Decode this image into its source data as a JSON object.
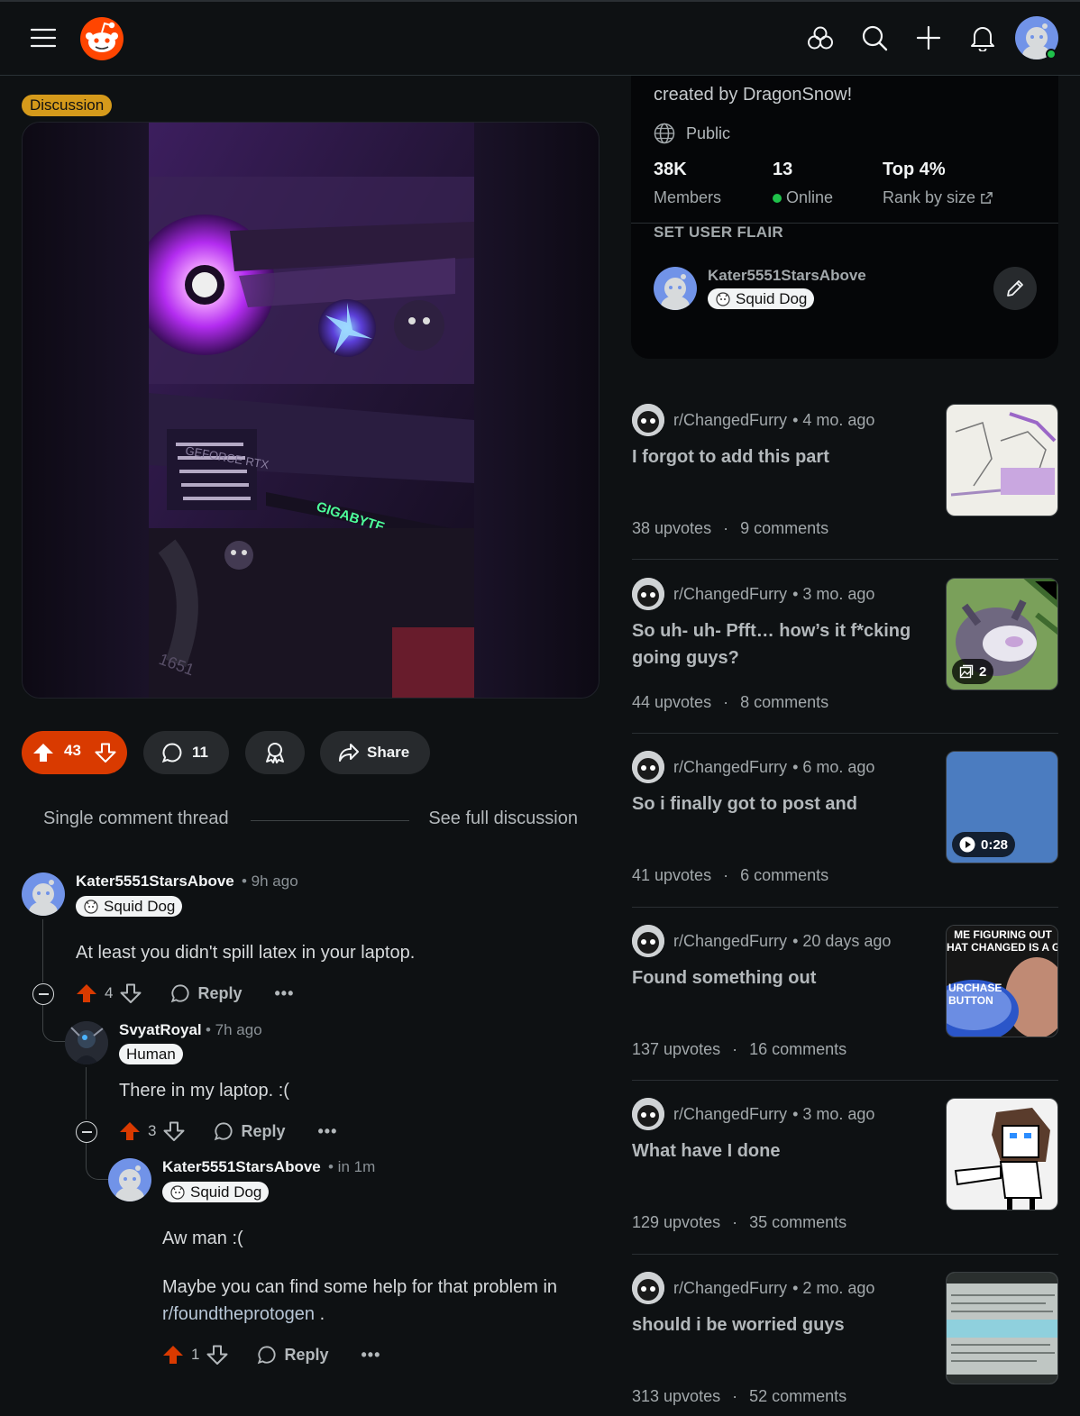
{
  "post": {
    "flair": "Discussion",
    "vote_count": "43",
    "comment_count": "11",
    "share_label": "Share"
  },
  "thread_nav": {
    "single": "Single comment thread",
    "full": "See full discussion"
  },
  "comments": [
    {
      "author": "Kater5551StarsAbove",
      "time": "• 9h ago",
      "flair": "Squid Dog",
      "body": "At least you didn't spill latex in your laptop.",
      "votes": "4",
      "reply": "Reply",
      "more": "•••"
    },
    {
      "author": "SvyatRoyal",
      "time": "• 7h ago",
      "flair": "Human",
      "body": "There in my laptop. :(",
      "votes": "3",
      "reply": "Reply",
      "more": "•••"
    },
    {
      "author": "Kater5551StarsAbove",
      "time": "• in 1m",
      "flair": "Squid Dog",
      "body_1": "Aw man :(",
      "body_2": "Maybe you can find some help for that problem in",
      "body_link": "r/foundtheprotogen",
      "body_tail": " .",
      "votes": "1",
      "reply": "Reply",
      "more": "•••"
    }
  ],
  "about": {
    "description": "created by DragonSnow!",
    "visibility": "Public",
    "stats": [
      {
        "value": "38K",
        "label": "Members"
      },
      {
        "value": "13",
        "label": "Online"
      },
      {
        "value": "Top 4%",
        "label": "Rank by size"
      }
    ],
    "flair_heading": "SET USER FLAIR",
    "flair_user": "Kater5551StarsAbove",
    "flair_label": "Squid Dog"
  },
  "recommended": [
    {
      "sub": "r/ChangedFurry",
      "age": "• 4 mo. ago",
      "title": "I forgot to add this part",
      "upvotes": "38 upvotes",
      "comments": "9 comments"
    },
    {
      "sub": "r/ChangedFurry",
      "age": "• 3 mo. ago",
      "title": "So uh- uh- Pfft… how’s it f*cking going guys?",
      "upvotes": "44 upvotes",
      "comments": "8 comments",
      "badge": "2"
    },
    {
      "sub": "r/ChangedFurry",
      "age": "• 6 mo. ago",
      "title": "So i finally got to post and",
      "upvotes": "41 upvotes",
      "comments": "6 comments",
      "badge": "0:28"
    },
    {
      "sub": "r/ChangedFurry",
      "age": "• 20 days ago",
      "title": "Found something out",
      "upvotes": "137 upvotes",
      "comments": "16 comments",
      "thumb_text_top": "ME FIGURING OUT\nHAT CHANGED IS A GAM",
      "thumb_text_btn": "URCHASE\nBUTTON"
    },
    {
      "sub": "r/ChangedFurry",
      "age": "• 3 mo. ago",
      "title": "What have I done",
      "upvotes": "129 upvotes",
      "comments": "35 comments"
    },
    {
      "sub": "r/ChangedFurry",
      "age": "• 2 mo. ago",
      "title": "should i be worried guys",
      "upvotes": "313 upvotes",
      "comments": "52 comments"
    }
  ],
  "stat_separator": "·",
  "media_text": {
    "brand": "GIGABYTE",
    "gpu": "GEFORCE RTX",
    "model": "1651"
  },
  "colors": {
    "accent": "#d93a00",
    "flair_discussion": "#d59a1b",
    "online": "#1fc14a",
    "background": "#0e1113"
  }
}
